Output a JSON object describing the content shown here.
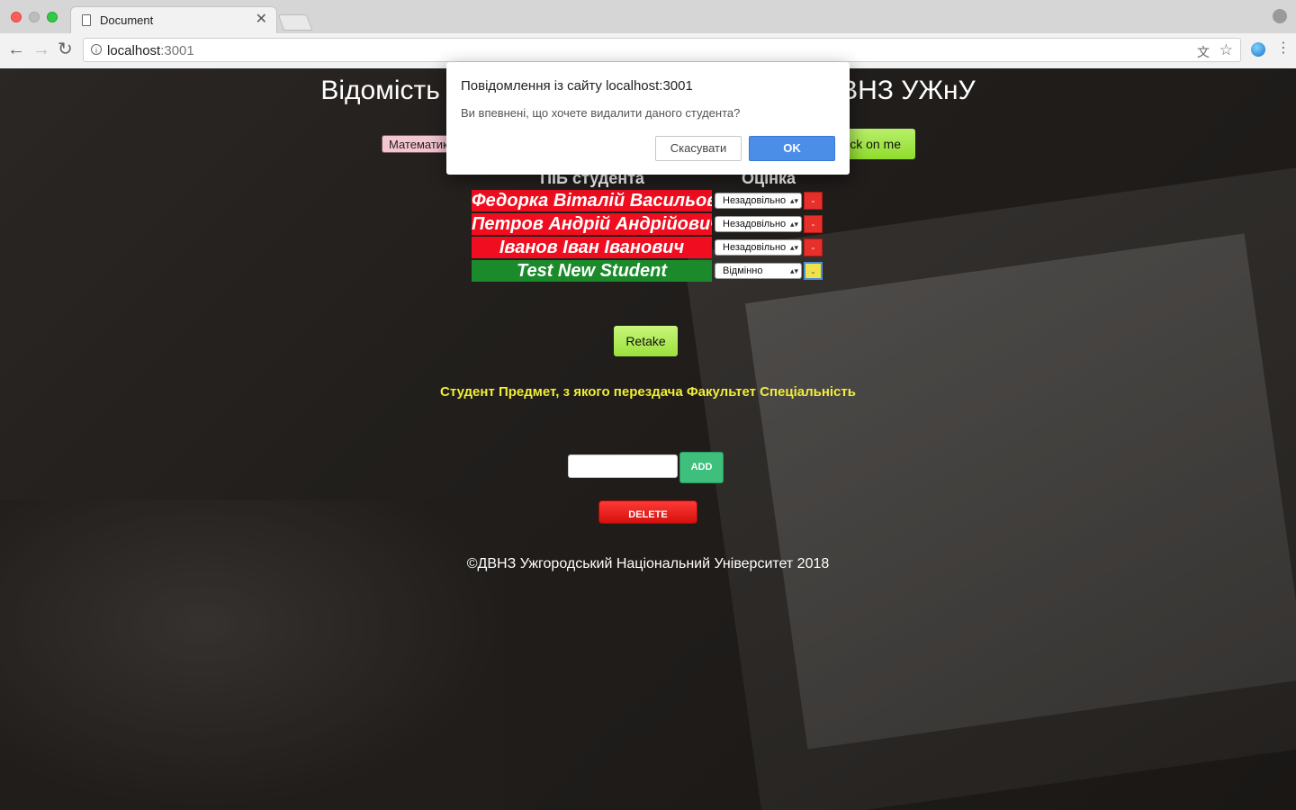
{
  "browser": {
    "tab_title": "Document",
    "tab_close": "✕",
    "url_host": "localhost",
    "url_port": ":3001",
    "nav": {
      "back": "←",
      "forward": "→",
      "reload": "↻"
    },
    "icons": [
      "page-icon",
      "info-icon",
      "translate-icon",
      "star-icon",
      "profile-icon",
      "extension-icon",
      "menu-icon"
    ]
  },
  "page": {
    "title": "Відомість складання заліку студентами ДВНЗ УЖнУ",
    "subject_select": "Математика",
    "click_button": "Click on me",
    "table": {
      "headers": {
        "name": "ПІБ студента",
        "grade": "Оцінка"
      },
      "rows": [
        {
          "name": "Федорка Віталій Васильович",
          "grade": "Незадовільно",
          "action": "-",
          "status": "fail"
        },
        {
          "name": "Петров Андрій Андрійович",
          "grade": "Незадовільно",
          "action": "-",
          "status": "fail"
        },
        {
          "name": "Іванов Іван Іванович",
          "grade": "Незадовільно",
          "action": "-",
          "status": "fail"
        },
        {
          "name": "Test New Student",
          "grade": "Відмінно",
          "action": "-",
          "status": "pass"
        }
      ]
    },
    "retake_button": "Retake",
    "info_line": "Студент Предмет, з якого перездача Факультет Спеціальність",
    "add_input_value": "",
    "add_button": "ADD",
    "delete_button": "DELETE",
    "footer": "©ДВНЗ Ужгородський Національний Університет 2018"
  },
  "dialog": {
    "title": "Повідомлення із сайту localhost:3001",
    "message": "Ви впевнені, що хочете видалити даного студента?",
    "cancel_label": "Скасувати",
    "ok_label": "OK"
  },
  "colors": {
    "fail_row": "#f00d1f",
    "pass_row": "#1a8a2a",
    "highlight_text": "#f0ee38",
    "ok_button": "#4a8ee8",
    "add_button": "#3fbf7c",
    "delete_button": "#e01b17"
  }
}
